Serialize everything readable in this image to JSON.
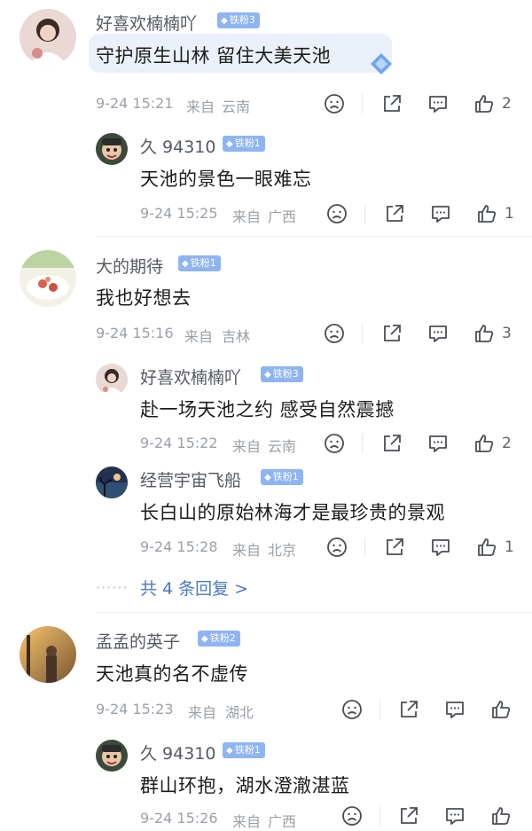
{
  "comments": [
    {
      "user": "好喜欢楠楠吖",
      "badge": "铁粉3",
      "text": "守护原生山林 留住大美天池",
      "time": "9-24 15:21",
      "from": "来自",
      "location": "云南",
      "likes": "2"
    },
    {
      "user": "久 94310",
      "badge": "铁粉1",
      "text": "天池的景色一眼难忘",
      "time": "9-24 15:25",
      "from": "来自",
      "location": "广西",
      "likes": "1"
    },
    {
      "user": "大的期待",
      "badge": "铁粉1",
      "text": "我也好想去",
      "time": "9-24 15:16",
      "from": "来自",
      "location": "吉林",
      "likes": "3"
    },
    {
      "user": "好喜欢楠楠吖",
      "badge": "铁粉3",
      "text": "赴一场天池之约 感受自然震撼",
      "time": "9-24 15:22",
      "from": "来自",
      "location": "云南",
      "likes": "2"
    },
    {
      "user": "经营宇宙飞船",
      "badge": "铁粉1",
      "text": "长白山的原始林海才是最珍贵的景观",
      "time": "9-24 15:28",
      "from": "来自",
      "location": "北京",
      "likes": "1"
    },
    {
      "user": "孟孟的英子",
      "badge": "铁粉2",
      "text": "天池真的名不虚传",
      "time": "9-24 15:23",
      "from": "来自",
      "location": "湖北",
      "likes": ""
    },
    {
      "user": "久 94310",
      "badge": "铁粉1",
      "text": "群山环抱，湖水澄澈湛蓝",
      "time": "9-24 15:26",
      "from": "来自",
      "location": "广西",
      "likes": ""
    }
  ],
  "more_replies": {
    "dots": "······",
    "label": "共 4 条回复 >"
  },
  "icons": {
    "badge": "diamond-icon",
    "dislike": "sad-face-icon",
    "share": "share-icon",
    "reply": "comment-icon",
    "like": "thumbs-up-icon"
  },
  "colors": {
    "badge": "#8fb4f2",
    "link": "#4a78c2",
    "meta": "#9aa0a6"
  }
}
